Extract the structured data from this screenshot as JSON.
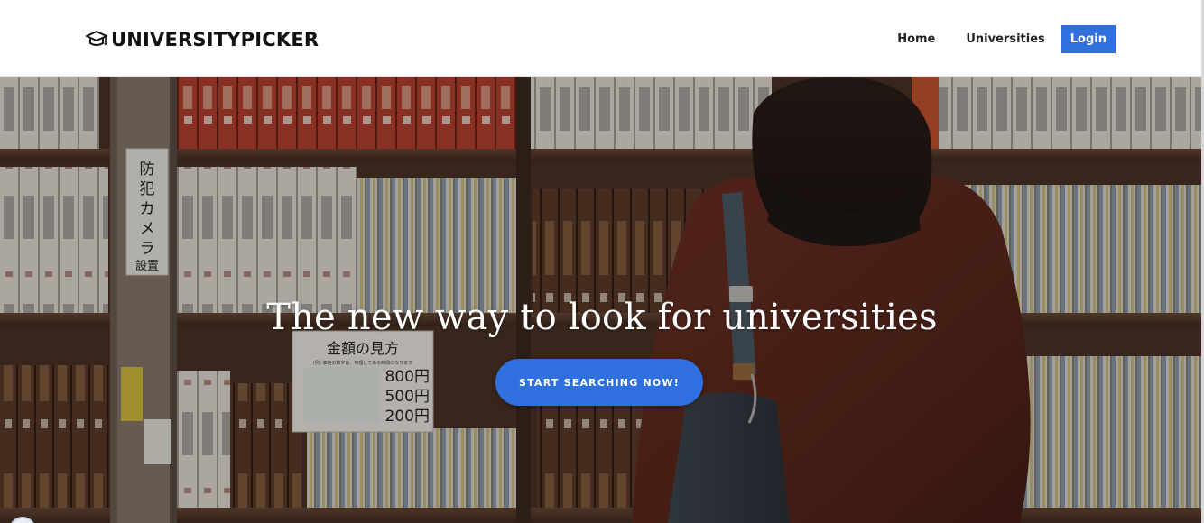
{
  "brand": {
    "name": "UNIVERSITYPICKER",
    "icon": "graduation-cap-icon"
  },
  "nav": {
    "home": "Home",
    "universities": "Universities",
    "login": "Login"
  },
  "hero": {
    "headline": "The new way to look for universities",
    "cta_label": "START SEARCHING NOW!",
    "background": "bookstore-shelves-photo",
    "sign_vertical": "防犯カメラ設置",
    "price_sign": {
      "title": "金額の見方",
      "note": "(例) 価格の数字は、無理してある時間になります",
      "prices": [
        "800円",
        "500円",
        "200円"
      ]
    }
  },
  "colors": {
    "accent": "#2f6fde",
    "nav_bg": "#ffffff",
    "text_dark": "#111111"
  }
}
